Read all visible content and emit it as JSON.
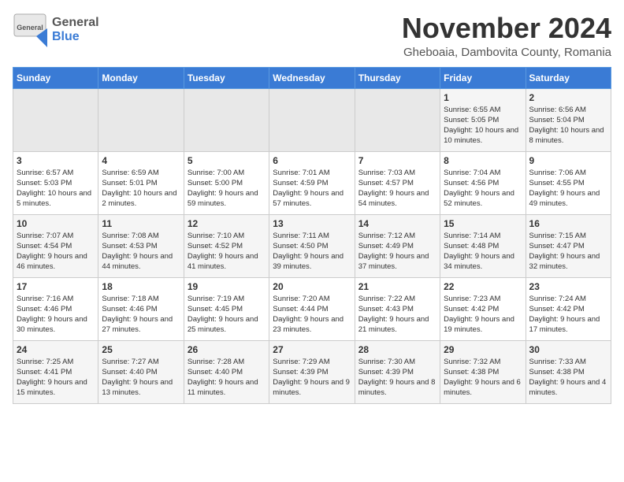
{
  "header": {
    "logo_general": "General",
    "logo_blue": "Blue",
    "month_title": "November 2024",
    "location": "Gheboaia, Dambovita County, Romania"
  },
  "days_of_week": [
    "Sunday",
    "Monday",
    "Tuesday",
    "Wednesday",
    "Thursday",
    "Friday",
    "Saturday"
  ],
  "weeks": [
    [
      {
        "day": "",
        "info": ""
      },
      {
        "day": "",
        "info": ""
      },
      {
        "day": "",
        "info": ""
      },
      {
        "day": "",
        "info": ""
      },
      {
        "day": "",
        "info": ""
      },
      {
        "day": "1",
        "info": "Sunrise: 6:55 AM\nSunset: 5:05 PM\nDaylight: 10 hours and 10 minutes."
      },
      {
        "day": "2",
        "info": "Sunrise: 6:56 AM\nSunset: 5:04 PM\nDaylight: 10 hours and 8 minutes."
      }
    ],
    [
      {
        "day": "3",
        "info": "Sunrise: 6:57 AM\nSunset: 5:03 PM\nDaylight: 10 hours and 5 minutes."
      },
      {
        "day": "4",
        "info": "Sunrise: 6:59 AM\nSunset: 5:01 PM\nDaylight: 10 hours and 2 minutes."
      },
      {
        "day": "5",
        "info": "Sunrise: 7:00 AM\nSunset: 5:00 PM\nDaylight: 9 hours and 59 minutes."
      },
      {
        "day": "6",
        "info": "Sunrise: 7:01 AM\nSunset: 4:59 PM\nDaylight: 9 hours and 57 minutes."
      },
      {
        "day": "7",
        "info": "Sunrise: 7:03 AM\nSunset: 4:57 PM\nDaylight: 9 hours and 54 minutes."
      },
      {
        "day": "8",
        "info": "Sunrise: 7:04 AM\nSunset: 4:56 PM\nDaylight: 9 hours and 52 minutes."
      },
      {
        "day": "9",
        "info": "Sunrise: 7:06 AM\nSunset: 4:55 PM\nDaylight: 9 hours and 49 minutes."
      }
    ],
    [
      {
        "day": "10",
        "info": "Sunrise: 7:07 AM\nSunset: 4:54 PM\nDaylight: 9 hours and 46 minutes."
      },
      {
        "day": "11",
        "info": "Sunrise: 7:08 AM\nSunset: 4:53 PM\nDaylight: 9 hours and 44 minutes."
      },
      {
        "day": "12",
        "info": "Sunrise: 7:10 AM\nSunset: 4:52 PM\nDaylight: 9 hours and 41 minutes."
      },
      {
        "day": "13",
        "info": "Sunrise: 7:11 AM\nSunset: 4:50 PM\nDaylight: 9 hours and 39 minutes."
      },
      {
        "day": "14",
        "info": "Sunrise: 7:12 AM\nSunset: 4:49 PM\nDaylight: 9 hours and 37 minutes."
      },
      {
        "day": "15",
        "info": "Sunrise: 7:14 AM\nSunset: 4:48 PM\nDaylight: 9 hours and 34 minutes."
      },
      {
        "day": "16",
        "info": "Sunrise: 7:15 AM\nSunset: 4:47 PM\nDaylight: 9 hours and 32 minutes."
      }
    ],
    [
      {
        "day": "17",
        "info": "Sunrise: 7:16 AM\nSunset: 4:46 PM\nDaylight: 9 hours and 30 minutes."
      },
      {
        "day": "18",
        "info": "Sunrise: 7:18 AM\nSunset: 4:46 PM\nDaylight: 9 hours and 27 minutes."
      },
      {
        "day": "19",
        "info": "Sunrise: 7:19 AM\nSunset: 4:45 PM\nDaylight: 9 hours and 25 minutes."
      },
      {
        "day": "20",
        "info": "Sunrise: 7:20 AM\nSunset: 4:44 PM\nDaylight: 9 hours and 23 minutes."
      },
      {
        "day": "21",
        "info": "Sunrise: 7:22 AM\nSunset: 4:43 PM\nDaylight: 9 hours and 21 minutes."
      },
      {
        "day": "22",
        "info": "Sunrise: 7:23 AM\nSunset: 4:42 PM\nDaylight: 9 hours and 19 minutes."
      },
      {
        "day": "23",
        "info": "Sunrise: 7:24 AM\nSunset: 4:42 PM\nDaylight: 9 hours and 17 minutes."
      }
    ],
    [
      {
        "day": "24",
        "info": "Sunrise: 7:25 AM\nSunset: 4:41 PM\nDaylight: 9 hours and 15 minutes."
      },
      {
        "day": "25",
        "info": "Sunrise: 7:27 AM\nSunset: 4:40 PM\nDaylight: 9 hours and 13 minutes."
      },
      {
        "day": "26",
        "info": "Sunrise: 7:28 AM\nSunset: 4:40 PM\nDaylight: 9 hours and 11 minutes."
      },
      {
        "day": "27",
        "info": "Sunrise: 7:29 AM\nSunset: 4:39 PM\nDaylight: 9 hours and 9 minutes."
      },
      {
        "day": "28",
        "info": "Sunrise: 7:30 AM\nSunset: 4:39 PM\nDaylight: 9 hours and 8 minutes."
      },
      {
        "day": "29",
        "info": "Sunrise: 7:32 AM\nSunset: 4:38 PM\nDaylight: 9 hours and 6 minutes."
      },
      {
        "day": "30",
        "info": "Sunrise: 7:33 AM\nSunset: 4:38 PM\nDaylight: 9 hours and 4 minutes."
      }
    ]
  ]
}
